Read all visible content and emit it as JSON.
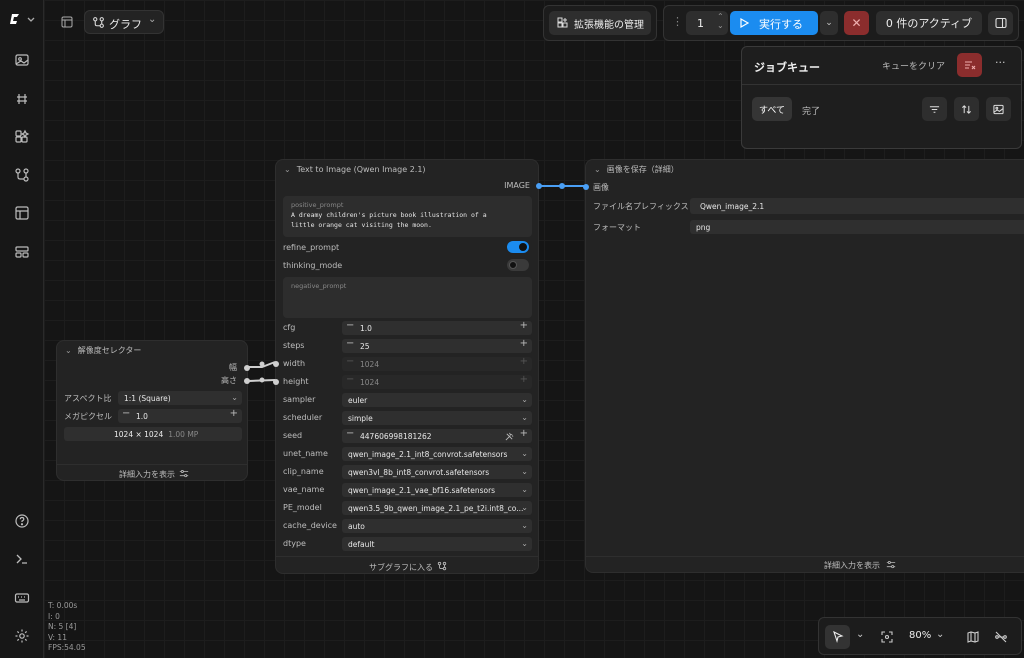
{
  "topbar": {
    "graph_label": "グラフ",
    "extensions_label": "拡張機能の管理",
    "run_count": "1",
    "run_label": "実行する",
    "active_label": "0 件のアクティブ"
  },
  "queue": {
    "title": "ジョブキュー",
    "clear_label": "キューをクリア",
    "tab_all": "すべて",
    "tab_done": "完了"
  },
  "t2i": {
    "title": "Text to Image (Qwen Image 2.1)",
    "output_label": "IMAGE",
    "prompt_label": "positive_prompt",
    "prompt_text": "A dreamy children's picture book illustration of a little orange cat visiting the moon.",
    "refine_label": "refine_prompt",
    "thinking_label": "thinking_mode",
    "neg_label": "negative_prompt",
    "cfg_label": "cfg",
    "cfg_value": "1.0",
    "steps_label": "steps",
    "steps_value": "25",
    "width_label": "width",
    "width_value": "1024",
    "height_label": "height",
    "height_value": "1024",
    "sampler_label": "sampler",
    "sampler_value": "euler",
    "scheduler_label": "scheduler",
    "scheduler_value": "simple",
    "seed_label": "seed",
    "seed_value": "447606998181262",
    "unet_label": "unet_name",
    "unet_value": "qwen_image_2.1_int8_convrot.safetensors",
    "clip_label": "clip_name",
    "clip_value": "qwen3vl_8b_int8_convrot.safetensors",
    "vae_label": "vae_name",
    "vae_value": "qwen_image_2.1_vae_bf16.safetensors",
    "pe_label": "PE_model",
    "pe_value": "qwen3.5_9b_qwen_image_2.1_pe_t2i.int8_co...",
    "cache_label": "cache_device",
    "cache_value": "auto",
    "dtype_label": "dtype",
    "dtype_value": "default",
    "footer_label": "サブグラフに入る"
  },
  "save": {
    "title": "画像を保存（詳細）",
    "input_label": "画像",
    "prefix_label": "ファイル名プレフィックス",
    "prefix_value": "Qwen_image_2.1",
    "format_label": "フォーマット",
    "format_value": "png",
    "footer_label": "詳細入力を表示"
  },
  "res": {
    "title": "解像度セレクター",
    "out_width": "幅",
    "out_height": "高さ",
    "aspect_label": "アスペクト比",
    "aspect_value": "1:1 (Square)",
    "mp_label": "メガピクセル",
    "mp_value": "1.0",
    "summary": "1024 × 1024",
    "summary_mp": "1.00 MP",
    "footer_label": "詳細入力を表示"
  },
  "stats": {
    "t": "T: 0.00s",
    "i": "I: 0",
    "n": "N: 5 [4]",
    "v": "V: 11",
    "fps": "FPS:54.05"
  },
  "bottombar": {
    "zoom": "80%"
  },
  "colors": {
    "accent": "#1b8cf0",
    "danger": "#8b2d2d",
    "link": "#4a9ff5"
  }
}
